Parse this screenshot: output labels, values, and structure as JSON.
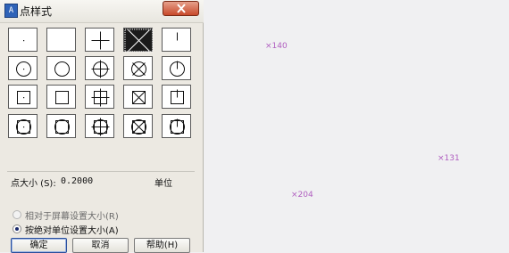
{
  "dialog": {
    "title": "点样式",
    "icon_label": "A"
  },
  "point_styles": {
    "selected_index": 3,
    "styles": [
      "dot",
      "none",
      "plus",
      "cross",
      "tick",
      "circle-dot",
      "circle",
      "circle-plus",
      "circle-cross",
      "circle-tick",
      "square-dot",
      "square",
      "square-plus",
      "square-cross",
      "square-tick",
      "circle-square-dot",
      "circle-square",
      "circle-square-plus",
      "circle-square-cross",
      "circle-square-tick"
    ]
  },
  "size": {
    "label": "点大小 (S):",
    "value": "0.2000",
    "unit_label": "单位"
  },
  "options": {
    "relative": "相对于屏幕设置大小(R)",
    "absolute": "按绝对单位设置大小(A)",
    "selected": "absolute"
  },
  "buttons": {
    "ok": "确定",
    "cancel": "取消",
    "help": "帮助(H)"
  },
  "canvas_markers": [
    {
      "label": "×140"
    },
    {
      "label": "×131"
    },
    {
      "label": "×204"
    }
  ]
}
